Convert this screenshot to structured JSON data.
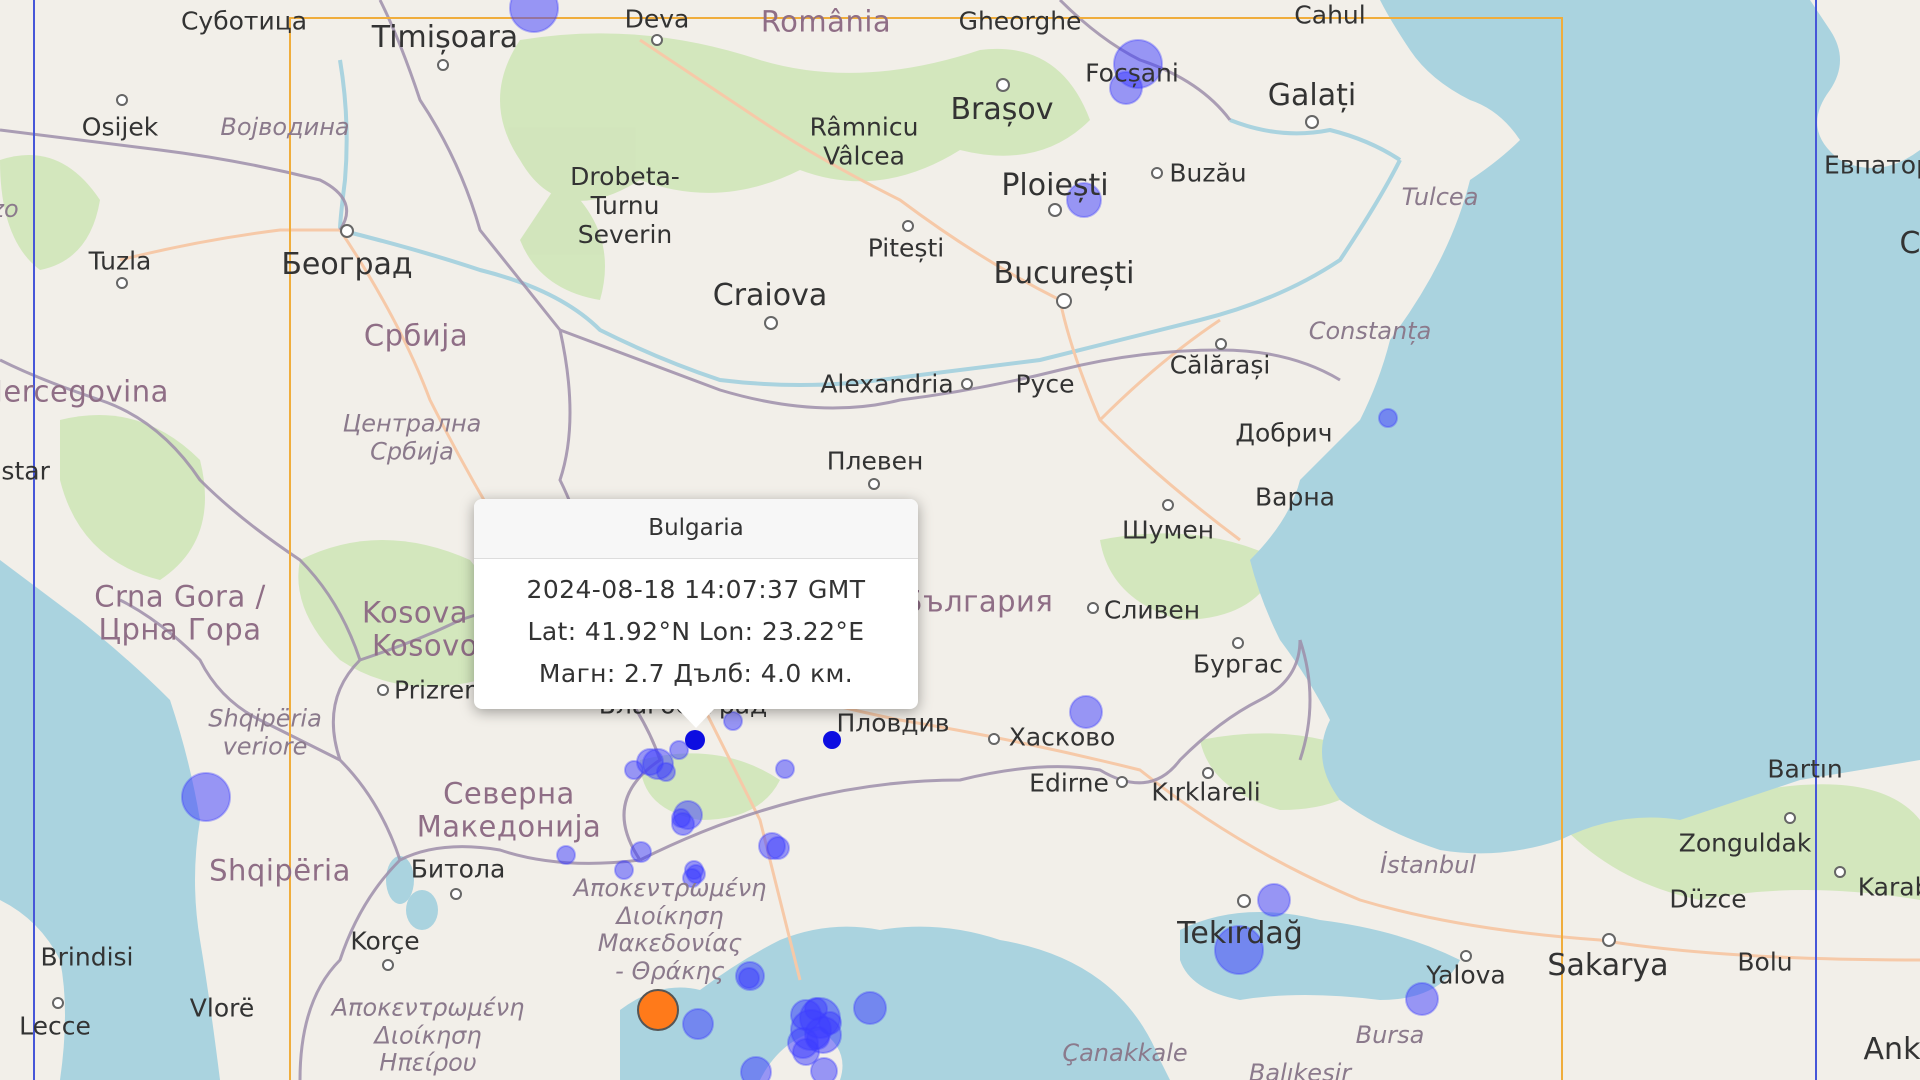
{
  "map": {
    "colors": {
      "sea": "#aad3df",
      "land": "#f2efe9",
      "forest": "#cfe5b8",
      "border": "#9e8eaa",
      "road": "#f6c9a8",
      "bbox_outer": "#4656d8",
      "bbox_inner": "#f0ad3c",
      "quake": "#3b3bff",
      "quake_highlight": "#0000e0",
      "quake_recent": "#ff7a1a"
    },
    "labels": [
      {
        "text": "Суботица",
        "cls": "city"
      },
      {
        "text": "Timișoara",
        "cls": "cityBig"
      },
      {
        "text": "Deva",
        "cls": "city"
      },
      {
        "text": "România",
        "cls": "country"
      },
      {
        "text": "Gheorghe",
        "cls": "city"
      },
      {
        "text": "Cahul",
        "cls": "city"
      },
      {
        "text": "Osijek",
        "cls": "city"
      },
      {
        "text": "Војводина",
        "cls": "region"
      },
      {
        "text": "Brașov",
        "cls": "cityBig"
      },
      {
        "text": "Focșani",
        "cls": "city"
      },
      {
        "text": "Galați",
        "cls": "cityBig"
      },
      {
        "text": "Râmnicu\nVâlcea",
        "cls": "city"
      },
      {
        "text": "Евпатор",
        "cls": "city"
      },
      {
        "text": "Drobeta-\nTurnu\nSeverin",
        "cls": "city"
      },
      {
        "text": "Ploiești",
        "cls": "cityBig"
      },
      {
        "text": "Buzău",
        "cls": "city"
      },
      {
        "text": "Tulcea",
        "cls": "region"
      },
      {
        "text": "Tuzla",
        "cls": "city"
      },
      {
        "text": "Београд",
        "cls": "cityBig"
      },
      {
        "text": "Pitești",
        "cls": "city"
      },
      {
        "text": "București",
        "cls": "cityBig"
      },
      {
        "text": "Craiova",
        "cls": "cityBig"
      },
      {
        "text": "Србија",
        "cls": "country"
      },
      {
        "text": "Constanța",
        "cls": "region"
      },
      {
        "text": "Hercegovina",
        "cls": "country"
      },
      {
        "text": "Alexandria",
        "cls": "city"
      },
      {
        "text": "Русе",
        "cls": "city"
      },
      {
        "text": "Călărași",
        "cls": "city"
      },
      {
        "text": "Централна\nСрбија",
        "cls": "region"
      },
      {
        "text": "Добрич",
        "cls": "city"
      },
      {
        "text": "ostar",
        "cls": "city"
      },
      {
        "text": "Плевен",
        "cls": "city"
      },
      {
        "text": "Варна",
        "cls": "city"
      },
      {
        "text": "Шумен",
        "cls": "city"
      },
      {
        "text": "Crna Gora /\nЦрна Гора",
        "cls": "country"
      },
      {
        "text": "Kosova /\nKosovo",
        "cls": "country"
      },
      {
        "text": "България",
        "cls": "country"
      },
      {
        "text": "Сливен",
        "cls": "city"
      },
      {
        "text": "Бургас",
        "cls": "city"
      },
      {
        "text": "Prizren",
        "cls": "city"
      },
      {
        "text": "Благоевград",
        "cls": "city"
      },
      {
        "text": "Пловдив",
        "cls": "city"
      },
      {
        "text": "Хасково",
        "cls": "city"
      },
      {
        "text": "Shqipëria\nveriore",
        "cls": "region"
      },
      {
        "text": "Северна\nМакедонија",
        "cls": "country"
      },
      {
        "text": "Edirne",
        "cls": "city"
      },
      {
        "text": "Kırklareli",
        "cls": "city"
      },
      {
        "text": "Bartın",
        "cls": "city"
      },
      {
        "text": "Zonguldak",
        "cls": "city"
      },
      {
        "text": "Shqipëria",
        "cls": "country"
      },
      {
        "text": "Битола",
        "cls": "city"
      },
      {
        "text": "Αποκεντρωμένη\nΔιοίκηση\nΜακεδονίας\n- Θράκης",
        "cls": "region"
      },
      {
        "text": "İstanbul",
        "cls": "region"
      },
      {
        "text": "Karabü",
        "cls": "city"
      },
      {
        "text": "Düzce",
        "cls": "city"
      },
      {
        "text": "Brindisi",
        "cls": "city"
      },
      {
        "text": "Korçe",
        "cls": "city"
      },
      {
        "text": "Tekirdağ",
        "cls": "cityBig"
      },
      {
        "text": "Sakarya",
        "cls": "cityBig"
      },
      {
        "text": "Bolu",
        "cls": "city"
      },
      {
        "text": "Yalova",
        "cls": "city"
      },
      {
        "text": "Lecce",
        "cls": "city"
      },
      {
        "text": "Vlorë",
        "cls": "city"
      },
      {
        "text": "Αποκεντρωμένη\nΔιοίκηση\nΗπείρου",
        "cls": "region"
      },
      {
        "text": "Bursa",
        "cls": "region"
      },
      {
        "text": "Çanakkale",
        "cls": "region"
      },
      {
        "text": "Balıkesir",
        "cls": "region"
      },
      {
        "text": "Ank",
        "cls": "cityBig"
      },
      {
        "text": "zo",
        "cls": "region"
      },
      {
        "text": "C",
        "cls": "cityBig"
      }
    ]
  },
  "popup": {
    "title": "Bulgaria",
    "datetime": "2024-08-18 14:07:37 GMT",
    "coords": "Lat: 41.92°N Lon: 23.22°E",
    "details": "Магн: 2.7 Дълб: 4.0 км."
  },
  "earthquakes": {
    "count_markers": 46
  }
}
